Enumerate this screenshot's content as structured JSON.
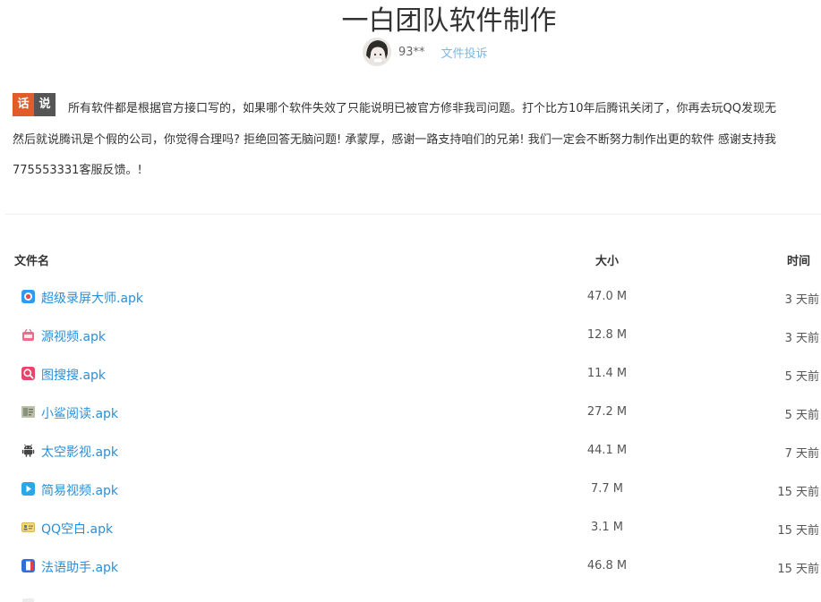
{
  "header": {
    "title": "一白团队软件制作",
    "author": "93**",
    "report_label": "文件投诉"
  },
  "notice": {
    "badge_left": "话",
    "badge_right": "说",
    "lines": [
      "所有软件都是根据官方接口写的，如果哪个软件失效了只能说明已被官方修非我司问题。打个比方10年后腾讯关闭了，你再去玩QQ发现无",
      "然后就说腾讯是个假的公司，你觉得合理吗? 拒绝回答无脑问题! 承蒙厚，感谢一路支持咱们的兄弟! 我们一定会不断努力制作出更的软件 感谢支持我",
      "775553331客服反馈。!"
    ]
  },
  "table": {
    "headers": {
      "name": "文件名",
      "size": "大小",
      "time": "时间"
    },
    "rows": [
      {
        "name": "超级录屏大师.apk",
        "size": "47.0 M",
        "time": "3 天前",
        "icon": "record-icon"
      },
      {
        "name": "源视频.apk",
        "size": "12.8 M",
        "time": "3 天前",
        "icon": "video-app-icon"
      },
      {
        "name": "图搜搜.apk",
        "size": "11.4 M",
        "time": "5 天前",
        "icon": "image-search-icon"
      },
      {
        "name": "小鲨阅读.apk",
        "size": "27.2 M",
        "time": "5 天前",
        "icon": "book-icon"
      },
      {
        "name": "太空影视.apk",
        "size": "44.1 M",
        "time": "7 天前",
        "icon": "android-icon"
      },
      {
        "name": "简易视频.apk",
        "size": "7.7 M",
        "time": "15 天前",
        "icon": "play-icon"
      },
      {
        "name": "QQ空白.apk",
        "size": "3.1 M",
        "time": "15 天前",
        "icon": "id-card-icon"
      },
      {
        "name": "法语助手.apk",
        "size": "46.8 M",
        "time": "15 天前",
        "icon": "flag-icon"
      },
      {
        "name": "",
        "size": "",
        "time": "",
        "icon": "file-icon"
      }
    ]
  },
  "colors": {
    "link": "#2a8fd8",
    "badge_orange": "#e25b2a",
    "badge_gray": "#555555",
    "report_link": "#7cb8e4"
  }
}
